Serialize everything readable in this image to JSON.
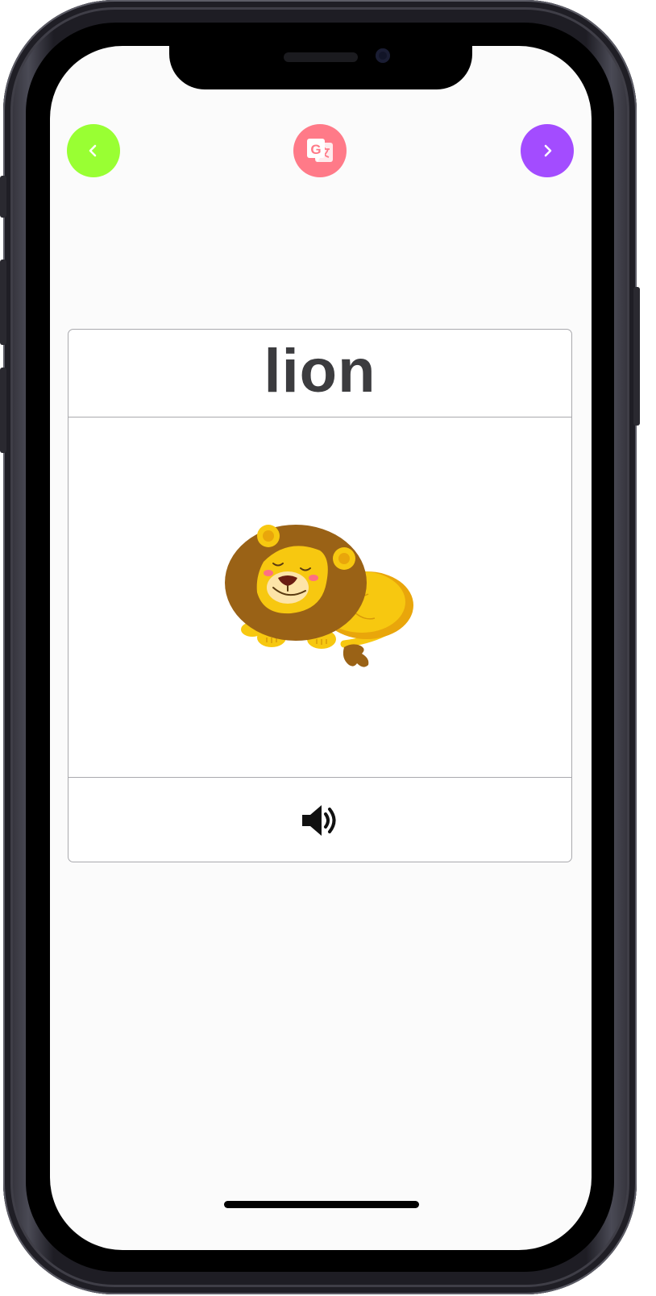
{
  "card": {
    "word": "lion",
    "image_subject": "sleeping-lion-illustration"
  },
  "nav": {
    "prev_icon": "chevron-left-icon",
    "translate_icon": "google-translate-icon",
    "next_icon": "chevron-right-icon"
  },
  "audio": {
    "icon": "speaker-volume-icon"
  },
  "colors": {
    "prev_button": "#99ff33",
    "translate_button": "#ff7a88",
    "next_button": "#a34cff",
    "word_text": "#3c3c3f",
    "lion_mane": "#9a6216",
    "lion_body": "#f7c810"
  }
}
